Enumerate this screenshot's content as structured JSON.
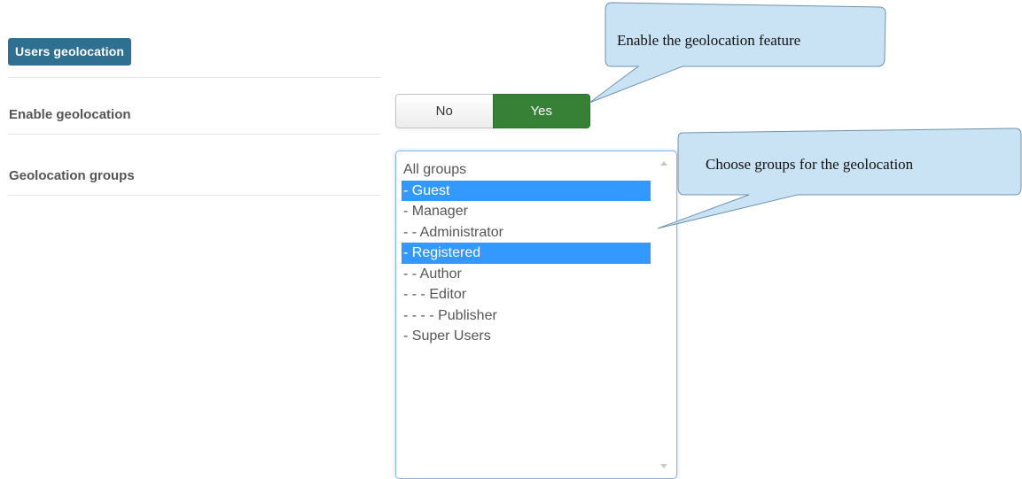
{
  "section": {
    "title": "Users geolocation"
  },
  "fields": {
    "enable_geolocation": {
      "label": "Enable geolocation",
      "options": [
        "No",
        "Yes"
      ],
      "selected": "Yes"
    },
    "geolocation_groups": {
      "label": "Geolocation groups",
      "options": [
        {
          "label": "All groups",
          "selected": false
        },
        {
          "label": "- Guest",
          "selected": true
        },
        {
          "label": "- Manager",
          "selected": false
        },
        {
          "label": "- - Administrator",
          "selected": false
        },
        {
          "label": "- Registered",
          "selected": true
        },
        {
          "label": "- - Author",
          "selected": false
        },
        {
          "label": "- - - Editor",
          "selected": false
        },
        {
          "label": "- - - - Publisher",
          "selected": false
        },
        {
          "label": "- Super Users",
          "selected": false
        }
      ]
    }
  },
  "callouts": {
    "geolocation_feature": "Enable the geolocation feature",
    "groups": "Choose groups for the geolocation"
  },
  "colors": {
    "badge": "#2f6f8f",
    "toggle_active": "#378137",
    "selection": "#3399ff",
    "callout_fill": "#c9e3f5"
  }
}
